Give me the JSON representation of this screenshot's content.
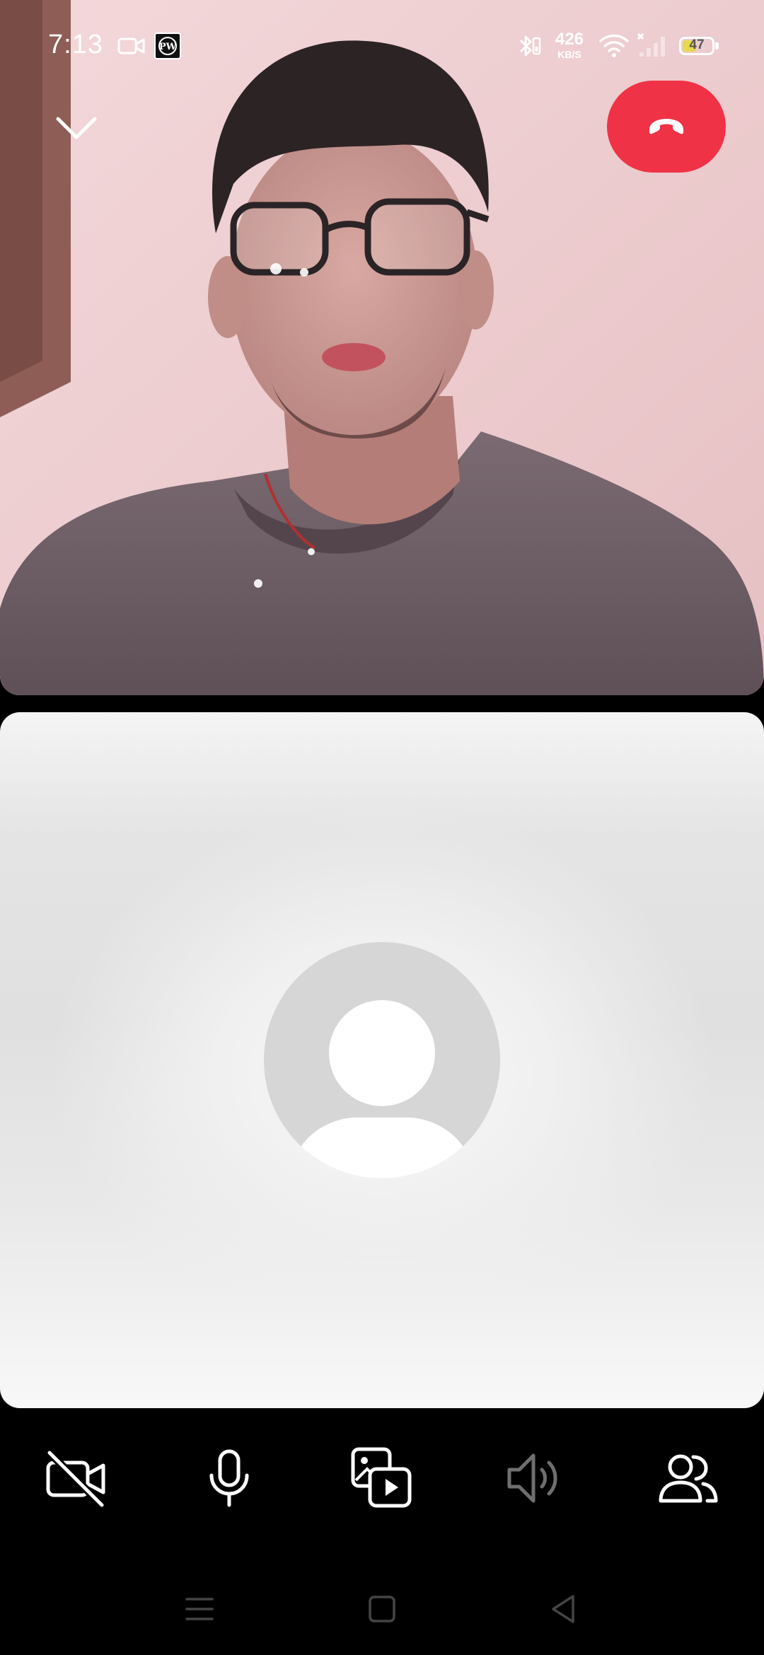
{
  "status_bar": {
    "time": "7:13",
    "network_speed_value": "426",
    "network_speed_unit": "KB/S",
    "battery_level": "47",
    "battery_percent": 47,
    "icons": [
      "video-camera-icon",
      "app-notification-icon",
      "bluetooth-icon",
      "wifi-icon",
      "signal-icon",
      "battery-icon"
    ]
  },
  "call": {
    "minimize_icon": "chevron-down-icon",
    "end_call_icon": "phone-hangup-icon",
    "end_call_color": "#f03246"
  },
  "remote_participant": {
    "video": "camera-feed"
  },
  "local_participant": {
    "avatar_icon": "person-placeholder-icon"
  },
  "controls": [
    {
      "icon": "camera-off-icon",
      "state": "off"
    },
    {
      "icon": "microphone-icon",
      "state": "on"
    },
    {
      "icon": "media-share-icon",
      "state": "available"
    },
    {
      "icon": "speaker-icon",
      "state": "disabled"
    },
    {
      "icon": "participants-icon",
      "state": "available"
    }
  ],
  "navigation": {
    "icons": [
      "menu-icon",
      "home-icon",
      "back-icon"
    ]
  }
}
